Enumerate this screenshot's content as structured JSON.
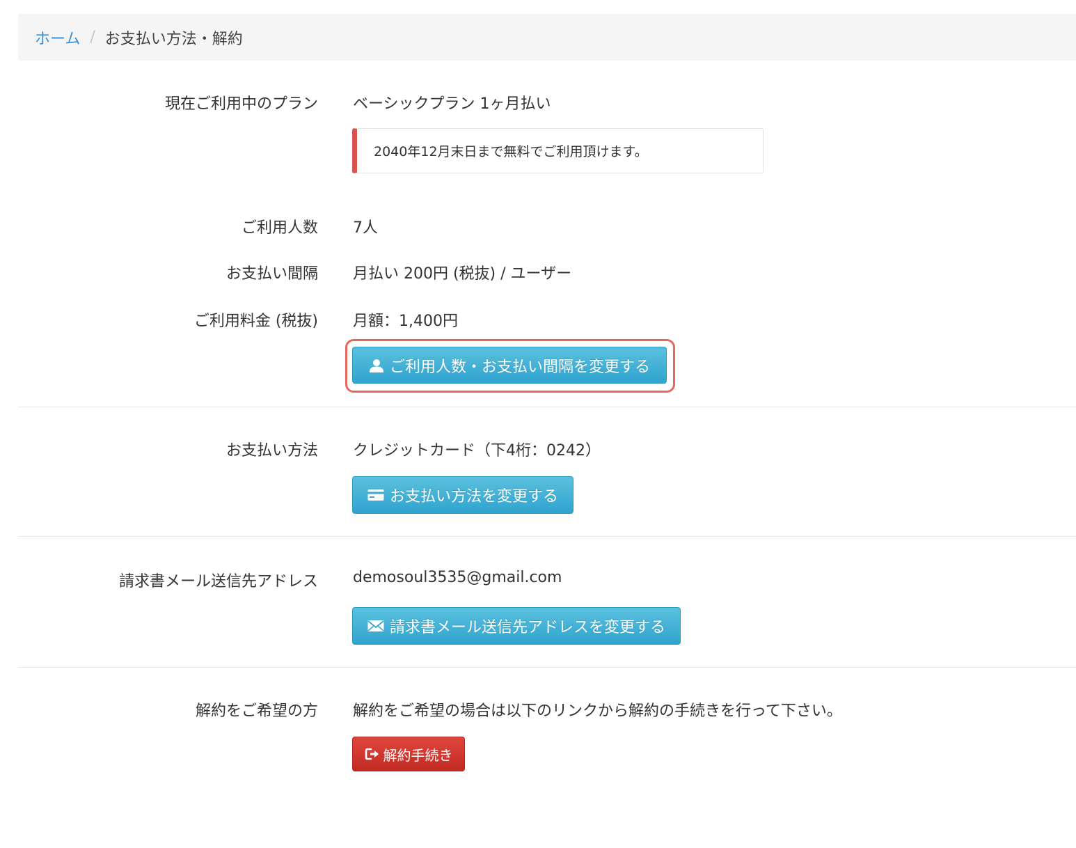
{
  "breadcrumb": {
    "home": "ホーム",
    "separator": "/",
    "current": "お支払い方法・解約"
  },
  "plan": {
    "label": "現在ご利用中のプラン",
    "value": "ベーシックプラン 1ヶ月払い",
    "notice": "2040年12月末日まで無料でご利用頂けます。"
  },
  "users": {
    "label": "ご利用人数",
    "value": "7人"
  },
  "interval": {
    "label": "お支払い間隔",
    "value": "月払い 200円 (税抜) / ユーザー"
  },
  "fee": {
    "label": "ご利用料金 (税抜)",
    "value": "月額：1,400円",
    "button": "ご利用人数・お支払い間隔を変更する"
  },
  "payment": {
    "label": "お支払い方法",
    "value": "クレジットカード（下4桁：0242）",
    "button": "お支払い方法を変更する"
  },
  "invoice": {
    "label": "請求書メール送信先アドレス",
    "value": "demosoul3535@gmail.com",
    "button": "請求書メール送信先アドレスを変更する"
  },
  "cancel": {
    "label": "解約をご希望の方",
    "value": "解約をご希望の場合は以下のリンクから解約の手続きを行って下さい。",
    "button": "解約手続き"
  },
  "colors": {
    "link": "#3a8fd0",
    "info_button": "#2fa4cf",
    "danger_button": "#c12a24",
    "notice_accent": "#d9534f",
    "highlight": "#e8675c"
  }
}
